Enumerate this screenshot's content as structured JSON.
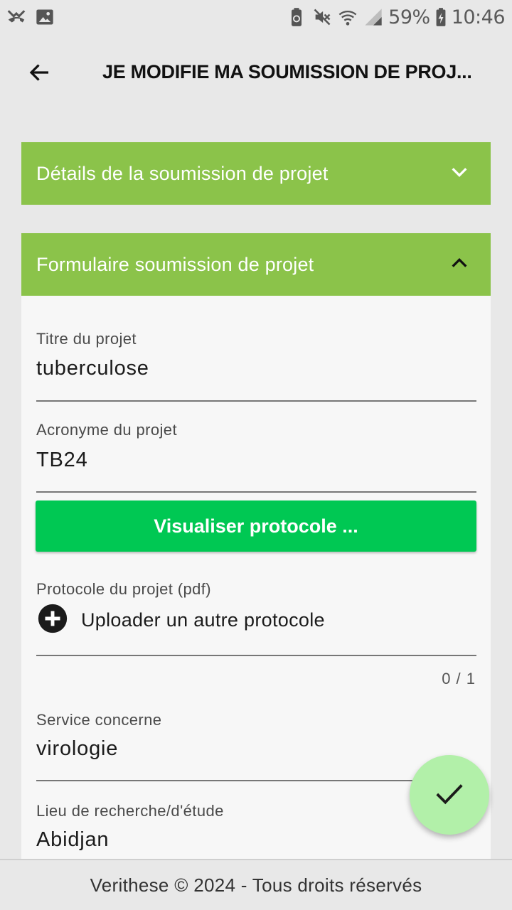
{
  "status_bar": {
    "battery_percent": "59%",
    "time": "10:46",
    "icons": [
      "missed-call-icon",
      "image-icon",
      "battery-saver-icon",
      "mute-icon",
      "wifi-icon",
      "signal-icon",
      "battery-charging-icon"
    ]
  },
  "app_bar": {
    "title": "JE MODIFIE MA SOUMISSION DE PROJ...",
    "back_icon": "arrow-back-icon"
  },
  "panels": [
    {
      "title": "Détails de la soumission de projet",
      "expanded": false,
      "icon": "chevron-down-icon"
    },
    {
      "title": "Formulaire soumission de projet",
      "expanded": true,
      "icon": "chevron-up-icon"
    }
  ],
  "form": {
    "titre": {
      "label": "Titre du projet",
      "value": "tuberculose"
    },
    "acronyme": {
      "label": "Acronyme du projet",
      "value": "TB24"
    },
    "visualiser_button": "Visualiser protocole ...",
    "protocole": {
      "label": "Protocole du projet (pdf)",
      "upload_label": "Uploader un autre protocole",
      "counter": "0 / 1"
    },
    "service": {
      "label": "Service concerne",
      "value": "virologie"
    },
    "lieu": {
      "label": "Lieu de recherche/d'étude",
      "value": "Abidjan"
    }
  },
  "fab": {
    "icon": "check-icon"
  },
  "footer": {
    "text": "Verithese © 2024 - Tous droits réservés"
  },
  "colors": {
    "panel_header": "#8bc34a",
    "visualiser_button": "#00c853",
    "fab": "#b2f0a9",
    "background": "#e8e8e8",
    "panel_body": "#f7f7f7"
  }
}
